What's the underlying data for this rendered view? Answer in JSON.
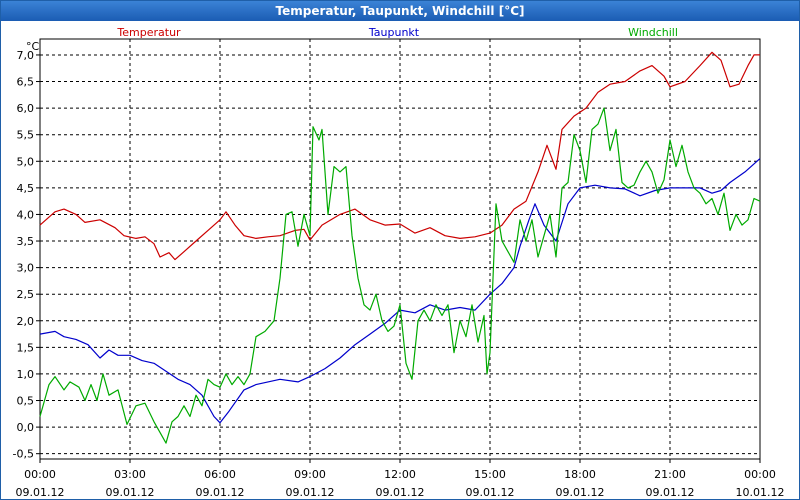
{
  "window": {
    "title": "Temperatur, Taupunkt, Windchill [°C]"
  },
  "chart_data": {
    "type": "line",
    "title": "Temperatur, Taupunkt, Windchill [°C]",
    "ylabel": "°C",
    "ylim": [
      -0.6,
      7.3
    ],
    "xlim": [
      0,
      24
    ],
    "grid": true,
    "legend_position": "top",
    "yticks": [
      "-0,5",
      "0,0",
      "0,5",
      "1,0",
      "1,5",
      "2,0",
      "2,5",
      "3,0",
      "3,5",
      "4,0",
      "4,5",
      "5,0",
      "5,5",
      "6,0",
      "6,5",
      "7,0"
    ],
    "ytick_values": [
      -0.5,
      0,
      0.5,
      1,
      1.5,
      2,
      2.5,
      3,
      3.5,
      4,
      4.5,
      5,
      5.5,
      6,
      6.5,
      7
    ],
    "xticks": [
      {
        "time": "00:00",
        "date": "09.01.12"
      },
      {
        "time": "03:00",
        "date": "09.01.12"
      },
      {
        "time": "06:00",
        "date": "09.01.12"
      },
      {
        "time": "09:00",
        "date": "09.01.12"
      },
      {
        "time": "12:00",
        "date": "09.01.12"
      },
      {
        "time": "15:00",
        "date": "09.01.12"
      },
      {
        "time": "18:00",
        "date": "09.01.12"
      },
      {
        "time": "21:00",
        "date": "09.01.12"
      },
      {
        "time": "00:00",
        "date": "10.01.12"
      }
    ],
    "xtick_values": [
      0,
      3,
      6,
      9,
      12,
      15,
      18,
      21,
      24
    ],
    "series": [
      {
        "name": "Temperatur",
        "color": "#cc0000",
        "points": [
          [
            0,
            3.8
          ],
          [
            0.5,
            4.05
          ],
          [
            0.8,
            4.1
          ],
          [
            1.2,
            4.0
          ],
          [
            1.5,
            3.85
          ],
          [
            2,
            3.9
          ],
          [
            2.5,
            3.75
          ],
          [
            2.8,
            3.6
          ],
          [
            3.2,
            3.55
          ],
          [
            3.5,
            3.58
          ],
          [
            3.8,
            3.45
          ],
          [
            4.0,
            3.2
          ],
          [
            4.3,
            3.28
          ],
          [
            4.5,
            3.15
          ],
          [
            4.8,
            3.3
          ],
          [
            5.2,
            3.5
          ],
          [
            5.6,
            3.7
          ],
          [
            6.0,
            3.9
          ],
          [
            6.2,
            4.05
          ],
          [
            6.5,
            3.8
          ],
          [
            6.8,
            3.6
          ],
          [
            7.2,
            3.55
          ],
          [
            7.6,
            3.58
          ],
          [
            8.0,
            3.6
          ],
          [
            8.5,
            3.7
          ],
          [
            8.8,
            3.72
          ],
          [
            9.0,
            3.52
          ],
          [
            9.4,
            3.8
          ],
          [
            10.0,
            4.0
          ],
          [
            10.5,
            4.1
          ],
          [
            11.0,
            3.9
          ],
          [
            11.5,
            3.8
          ],
          [
            12.0,
            3.82
          ],
          [
            12.5,
            3.65
          ],
          [
            13.0,
            3.75
          ],
          [
            13.5,
            3.6
          ],
          [
            14.0,
            3.55
          ],
          [
            14.5,
            3.58
          ],
          [
            15.0,
            3.65
          ],
          [
            15.4,
            3.8
          ],
          [
            15.8,
            4.1
          ],
          [
            16.2,
            4.25
          ],
          [
            16.6,
            4.8
          ],
          [
            16.9,
            5.3
          ],
          [
            17.2,
            4.85
          ],
          [
            17.4,
            5.6
          ],
          [
            17.8,
            5.85
          ],
          [
            18.2,
            6.0
          ],
          [
            18.6,
            6.3
          ],
          [
            19.0,
            6.45
          ],
          [
            19.5,
            6.5
          ],
          [
            20.0,
            6.7
          ],
          [
            20.4,
            6.8
          ],
          [
            20.8,
            6.6
          ],
          [
            21.0,
            6.4
          ],
          [
            21.5,
            6.5
          ],
          [
            22.0,
            6.8
          ],
          [
            22.4,
            7.05
          ],
          [
            22.7,
            6.9
          ],
          [
            23.0,
            6.4
          ],
          [
            23.3,
            6.45
          ],
          [
            23.6,
            6.8
          ],
          [
            23.8,
            7.0
          ],
          [
            24.0,
            7.0
          ]
        ]
      },
      {
        "name": "Taupunkt",
        "color": "#0000cc",
        "points": [
          [
            0,
            1.75
          ],
          [
            0.5,
            1.8
          ],
          [
            0.8,
            1.7
          ],
          [
            1.2,
            1.65
          ],
          [
            1.6,
            1.55
          ],
          [
            2,
            1.3
          ],
          [
            2.3,
            1.45
          ],
          [
            2.6,
            1.35
          ],
          [
            3.0,
            1.35
          ],
          [
            3.4,
            1.25
          ],
          [
            3.8,
            1.2
          ],
          [
            4.2,
            1.05
          ],
          [
            4.6,
            0.9
          ],
          [
            5.0,
            0.8
          ],
          [
            5.4,
            0.6
          ],
          [
            5.8,
            0.2
          ],
          [
            6.0,
            0.08
          ],
          [
            6.3,
            0.3
          ],
          [
            6.8,
            0.7
          ],
          [
            7.2,
            0.8
          ],
          [
            7.6,
            0.85
          ],
          [
            8.0,
            0.9
          ],
          [
            8.6,
            0.85
          ],
          [
            9.0,
            0.95
          ],
          [
            9.5,
            1.1
          ],
          [
            10.0,
            1.3
          ],
          [
            10.5,
            1.55
          ],
          [
            11.0,
            1.75
          ],
          [
            11.5,
            1.95
          ],
          [
            12.0,
            2.2
          ],
          [
            12.5,
            2.15
          ],
          [
            13.0,
            2.3
          ],
          [
            13.5,
            2.2
          ],
          [
            14.0,
            2.25
          ],
          [
            14.5,
            2.2
          ],
          [
            15.0,
            2.5
          ],
          [
            15.4,
            2.7
          ],
          [
            15.8,
            3.0
          ],
          [
            16.0,
            3.4
          ],
          [
            16.3,
            3.9
          ],
          [
            16.5,
            4.2
          ],
          [
            16.8,
            3.8
          ],
          [
            17.2,
            3.5
          ],
          [
            17.6,
            4.2
          ],
          [
            18.0,
            4.5
          ],
          [
            18.5,
            4.55
          ],
          [
            19.0,
            4.5
          ],
          [
            19.5,
            4.48
          ],
          [
            20.0,
            4.35
          ],
          [
            20.5,
            4.45
          ],
          [
            21.0,
            4.5
          ],
          [
            21.5,
            4.5
          ],
          [
            22.0,
            4.5
          ],
          [
            22.4,
            4.4
          ],
          [
            22.7,
            4.45
          ],
          [
            23.0,
            4.6
          ],
          [
            23.5,
            4.8
          ],
          [
            24.0,
            5.05
          ]
        ]
      },
      {
        "name": "Windchill",
        "color": "#00aa00",
        "points": [
          [
            0,
            0.2
          ],
          [
            0.3,
            0.8
          ],
          [
            0.5,
            0.95
          ],
          [
            0.8,
            0.7
          ],
          [
            1.0,
            0.85
          ],
          [
            1.3,
            0.75
          ],
          [
            1.5,
            0.5
          ],
          [
            1.7,
            0.8
          ],
          [
            1.9,
            0.5
          ],
          [
            2.1,
            1.0
          ],
          [
            2.3,
            0.6
          ],
          [
            2.6,
            0.7
          ],
          [
            2.9,
            0.05
          ],
          [
            3.2,
            0.4
          ],
          [
            3.5,
            0.45
          ],
          [
            3.8,
            0.1
          ],
          [
            4.0,
            -0.1
          ],
          [
            4.2,
            -0.3
          ],
          [
            4.4,
            0.1
          ],
          [
            4.6,
            0.2
          ],
          [
            4.8,
            0.4
          ],
          [
            5.0,
            0.2
          ],
          [
            5.2,
            0.6
          ],
          [
            5.4,
            0.4
          ],
          [
            5.6,
            0.9
          ],
          [
            5.8,
            0.8
          ],
          [
            6.0,
            0.75
          ],
          [
            6.2,
            1.0
          ],
          [
            6.4,
            0.8
          ],
          [
            6.6,
            0.95
          ],
          [
            6.8,
            0.8
          ],
          [
            7.0,
            1.0
          ],
          [
            7.2,
            1.7
          ],
          [
            7.5,
            1.8
          ],
          [
            7.8,
            2.0
          ],
          [
            8.0,
            2.8
          ],
          [
            8.2,
            4.0
          ],
          [
            8.4,
            4.05
          ],
          [
            8.6,
            3.4
          ],
          [
            8.8,
            4.0
          ],
          [
            9.0,
            3.6
          ],
          [
            9.1,
            5.65
          ],
          [
            9.3,
            5.4
          ],
          [
            9.4,
            5.6
          ],
          [
            9.6,
            4.0
          ],
          [
            9.8,
            4.9
          ],
          [
            10.0,
            4.8
          ],
          [
            10.2,
            4.9
          ],
          [
            10.4,
            3.6
          ],
          [
            10.6,
            2.8
          ],
          [
            10.8,
            2.3
          ],
          [
            11.0,
            2.2
          ],
          [
            11.2,
            2.5
          ],
          [
            11.4,
            2.0
          ],
          [
            11.6,
            1.8
          ],
          [
            11.8,
            1.9
          ],
          [
            12.0,
            2.3
          ],
          [
            12.2,
            1.2
          ],
          [
            12.4,
            0.9
          ],
          [
            12.6,
            2.0
          ],
          [
            12.8,
            2.2
          ],
          [
            13.0,
            2.0
          ],
          [
            13.2,
            2.3
          ],
          [
            13.4,
            2.1
          ],
          [
            13.6,
            2.3
          ],
          [
            13.8,
            1.4
          ],
          [
            14.0,
            2.0
          ],
          [
            14.2,
            1.7
          ],
          [
            14.4,
            2.3
          ],
          [
            14.6,
            1.6
          ],
          [
            14.8,
            2.1
          ],
          [
            14.9,
            1.0
          ],
          [
            15.0,
            1.4
          ],
          [
            15.2,
            4.2
          ],
          [
            15.4,
            3.5
          ],
          [
            15.6,
            3.3
          ],
          [
            15.8,
            3.1
          ],
          [
            16.0,
            3.9
          ],
          [
            16.2,
            3.5
          ],
          [
            16.4,
            3.9
          ],
          [
            16.6,
            3.2
          ],
          [
            16.8,
            3.6
          ],
          [
            17.0,
            4.0
          ],
          [
            17.2,
            3.2
          ],
          [
            17.4,
            4.5
          ],
          [
            17.6,
            4.6
          ],
          [
            17.8,
            5.5
          ],
          [
            18.0,
            5.2
          ],
          [
            18.2,
            4.6
          ],
          [
            18.4,
            5.6
          ],
          [
            18.6,
            5.7
          ],
          [
            18.8,
            6.0
          ],
          [
            19.0,
            5.2
          ],
          [
            19.2,
            5.6
          ],
          [
            19.4,
            4.6
          ],
          [
            19.6,
            4.5
          ],
          [
            19.8,
            4.55
          ],
          [
            20.0,
            4.8
          ],
          [
            20.2,
            5.0
          ],
          [
            20.4,
            4.8
          ],
          [
            20.6,
            4.4
          ],
          [
            20.8,
            4.65
          ],
          [
            21.0,
            5.4
          ],
          [
            21.2,
            4.9
          ],
          [
            21.4,
            5.3
          ],
          [
            21.6,
            4.8
          ],
          [
            21.8,
            4.5
          ],
          [
            22.0,
            4.4
          ],
          [
            22.2,
            4.2
          ],
          [
            22.4,
            4.3
          ],
          [
            22.6,
            4.0
          ],
          [
            22.8,
            4.4
          ],
          [
            23.0,
            3.7
          ],
          [
            23.2,
            4.0
          ],
          [
            23.4,
            3.8
          ],
          [
            23.6,
            3.9
          ],
          [
            23.8,
            4.3
          ],
          [
            24.0,
            4.25
          ]
        ]
      }
    ]
  }
}
